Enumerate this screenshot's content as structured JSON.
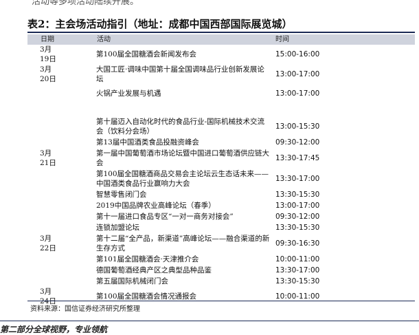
{
  "top_text": "活动等多项活动陆续开展。",
  "caption": "表2：主会场活动指引（地址：成都中国西部国际展览城）",
  "headers": [
    "日期",
    "活动",
    "时间"
  ],
  "rows": [
    {
      "date": "3月19日",
      "activity": "第100届全国糖酒会新闻发布会",
      "time": "15:00-16:00"
    },
    {
      "date": "3月20日",
      "activity": "大国工匠·调味中国第十届全国调味品行业创新发展论坛",
      "time": "13:00-17:00"
    },
    {
      "date": "",
      "activity": "火锅产业发展与机遇",
      "time": "13:00-17:00"
    },
    {
      "date": "",
      "activity": "",
      "time": ""
    },
    {
      "date": "",
      "activity": "第十届迈入自动化时代的食品行业-国际机械技术交流会（饮料分会场）",
      "time": "13:00-15:30"
    },
    {
      "date": "",
      "activity": "第13届中国酒类食品投融资峰会",
      "time": "09:30-12:00"
    },
    {
      "date": "3月21日",
      "activity": "第一届中国葡萄酒市场论坛暨中国进口葡萄酒供应链大会",
      "time": "13:30-17:45"
    },
    {
      "date": "",
      "activity": "第100届全国糖酒商品交易会主论坛云生态话未来——中国酒类食品行业赢响力大会",
      "time": "13:30-17:00"
    },
    {
      "date": "",
      "activity": "智慧零售闭门会",
      "time": "13:30-15:30"
    },
    {
      "date": "",
      "activity": "2019中国品牌农业高峰论坛（春季）",
      "time": "13:00-17:00"
    },
    {
      "date": "",
      "activity": "第十一届进口食品专区“一对一商务对接会”",
      "time": "09:30-12:00"
    },
    {
      "date": "",
      "activity": "连锁加盟论坛",
      "time": "13:30-15:30"
    },
    {
      "date": "3月22日",
      "activity": "第十二届“全产品，新渠道”高峰论坛——融合渠道的新生存方式",
      "time": "09:30-16:30"
    },
    {
      "date": "",
      "activity": "第101届全国糖酒会·天津推介会",
      "time": "10:00-11:00"
    },
    {
      "date": "",
      "activity": "德国葡萄酒经典产区之典型品种品鉴",
      "time": "13:30-17:00"
    },
    {
      "date": "",
      "activity": "第五届国际机械闭门会",
      "time": "13:30-15:30"
    },
    {
      "date": "3月24日",
      "activity": "第100届全国糖酒会情况通报会",
      "time": "10:00-11:00"
    }
  ],
  "source": "资料来源：国信证券经济研究所整理",
  "footer": "第二部分全球视野，专业领航"
}
